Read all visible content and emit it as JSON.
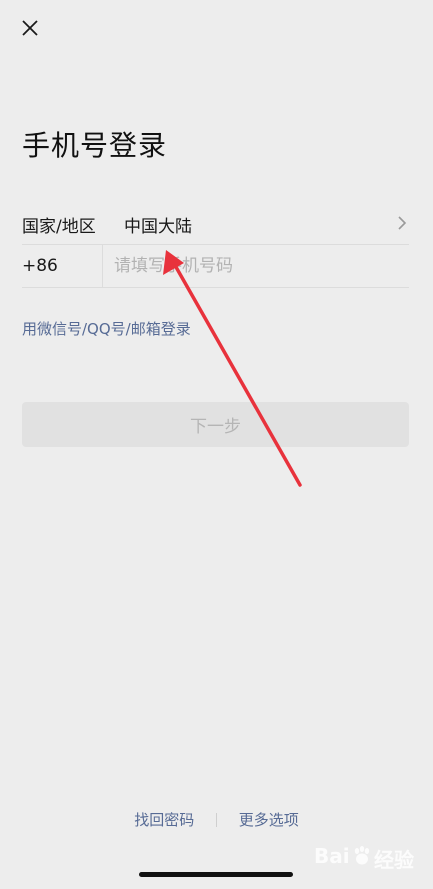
{
  "title": "手机号登录",
  "region": {
    "label": "国家/地区",
    "value": "中国大陆"
  },
  "phone": {
    "code": "+86",
    "placeholder": "请填写手机号码",
    "value": ""
  },
  "alt_login_label": "用微信号/QQ号/邮箱登录",
  "next_label": "下一步",
  "footer": {
    "recover_password": "找回密码",
    "more_options": "更多选项"
  },
  "watermark": {
    "text_left": "Bai",
    "text_right": "经验"
  },
  "colors": {
    "background": "#ededed",
    "link": "#576b95",
    "button_disabled": "#e1e1e1",
    "annotation_arrow": "#e8323c"
  }
}
